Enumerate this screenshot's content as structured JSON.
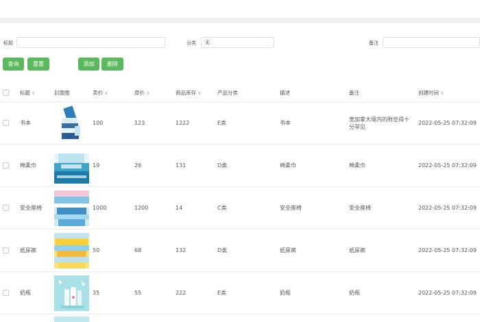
{
  "filters": {
    "title_label": "标题",
    "title_value": "",
    "category_label": "分类",
    "category_value": "无",
    "note_label": "备注",
    "note_value": ""
  },
  "buttons": {
    "query": "查询",
    "reset": "重置",
    "add": "添加",
    "delete": "删除"
  },
  "table": {
    "columns": [
      "",
      "标题",
      "封面图",
      "卖价",
      "原价",
      "商品库存",
      "产品分类",
      "描述",
      "备注",
      "创建时间"
    ],
    "sortable": [
      "标题",
      "卖价",
      "原价",
      "商品库存",
      "创建时间"
    ],
    "rows": [
      {
        "title": "书本",
        "price": "100",
        "original": "123",
        "stock": "1222",
        "category": "E类",
        "desc": "书本",
        "note": "宽加拿大境内的附览得十分罕见",
        "created": "2022-05-25 07:32:09",
        "thumb": "books"
      },
      {
        "title": "棉柔巾",
        "price": "19",
        "original": "26",
        "stock": "131",
        "category": "D类",
        "desc": "棉柔巾",
        "note": "棉柔巾",
        "created": "2022-05-25 07:32:09",
        "thumb": "tissue"
      },
      {
        "title": "安全座椅",
        "price": "1000",
        "original": "1200",
        "stock": "14",
        "category": "C类",
        "desc": "安全座椅",
        "note": "安全座椅",
        "created": "2022-05-25 07:32:09",
        "thumb": "seat"
      },
      {
        "title": "纸尿裤",
        "price": "50",
        "original": "68",
        "stock": "132",
        "category": "D类",
        "desc": "纸尿裤",
        "note": "纸尿裤",
        "created": "2022-05-25 07:32:09",
        "thumb": "diaper"
      },
      {
        "title": "奶瓶",
        "price": "35",
        "original": "55",
        "stock": "222",
        "category": "E类",
        "desc": "奶瓶",
        "note": "奶瓶",
        "created": "2022-05-25 07:32:09",
        "thumb": "bottle"
      }
    ]
  },
  "colors": {
    "button": "#5cb85c",
    "border": "#ebeef5",
    "topbar": "#f0f0f0"
  }
}
